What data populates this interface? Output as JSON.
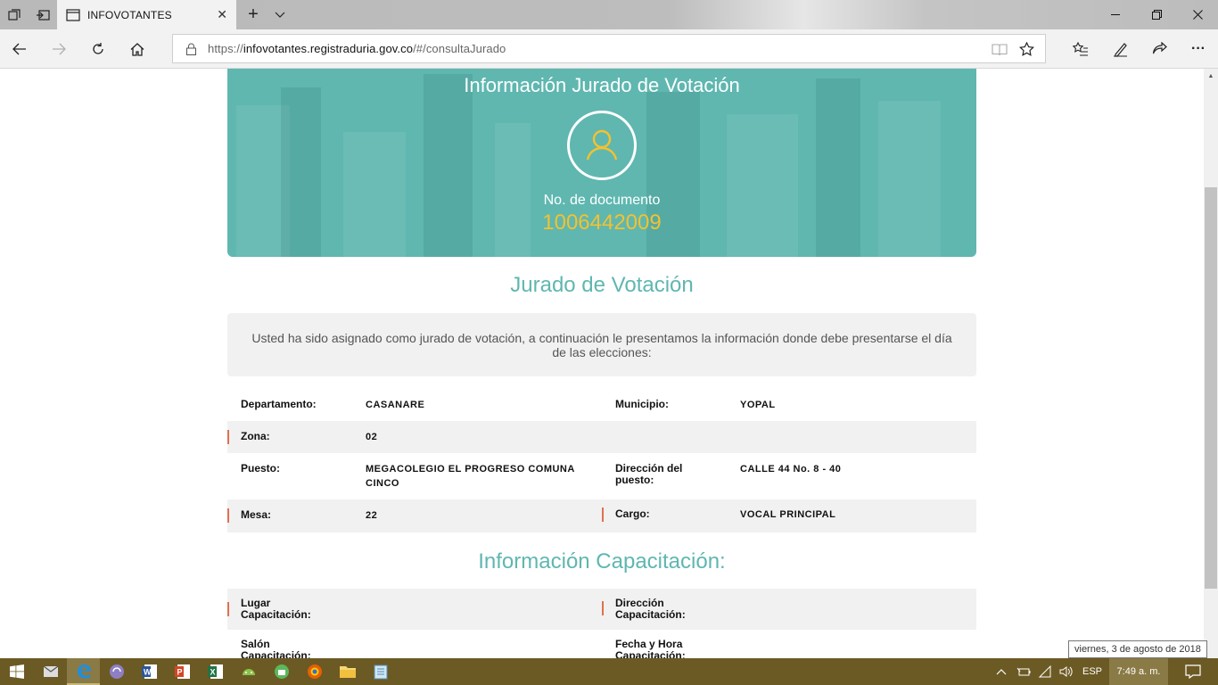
{
  "browser": {
    "tab_title": "INFOVOTANTES",
    "url_prefix": "https://",
    "url_host": "infovotantes.registraduria.gov.co",
    "url_path": "/#/consultaJurado"
  },
  "hero": {
    "title": "Información Jurado de Votación",
    "doc_label": "No. de documento",
    "doc_number": "1006442009"
  },
  "jurado": {
    "section_title": "Jurado de Votación",
    "notice": "Usted ha sido asignado como jurado de votación, a continuación le presentamos la información donde debe presentarse el día de las elecciones:",
    "departamento_label": "Departamento:",
    "departamento_value": "CASANARE",
    "municipio_label": "Municipio:",
    "municipio_value": "YOPAL",
    "zona_label": "Zona:",
    "zona_value": "02",
    "puesto_label": "Puesto:",
    "puesto_value": "MEGACOLEGIO EL PROGRESO COMUNA CINCO",
    "direccion_puesto_label": "Dirección del puesto:",
    "direccion_puesto_value": "CALLE 44 No. 8 - 40",
    "mesa_label": "Mesa:",
    "mesa_value": "22",
    "cargo_label": "Cargo:",
    "cargo_value": "VOCAL PRINCIPAL"
  },
  "capacitacion": {
    "section_title": "Información Capacitación:",
    "lugar_label": "Lugar Capacitación:",
    "direccion_label": "Dirección Capacitación:",
    "salon_label": "Salón Capacitación:",
    "fecha_label": "Fecha y Hora Capacitación:"
  },
  "taskbar": {
    "language": "ESP",
    "time": "7:49 a. m.",
    "date_tooltip": "viernes, 3 de agosto de 2018"
  },
  "colors": {
    "accent": "#5fb7b0",
    "doc_number": "#f3c22f",
    "row_marker": "#e07050"
  }
}
